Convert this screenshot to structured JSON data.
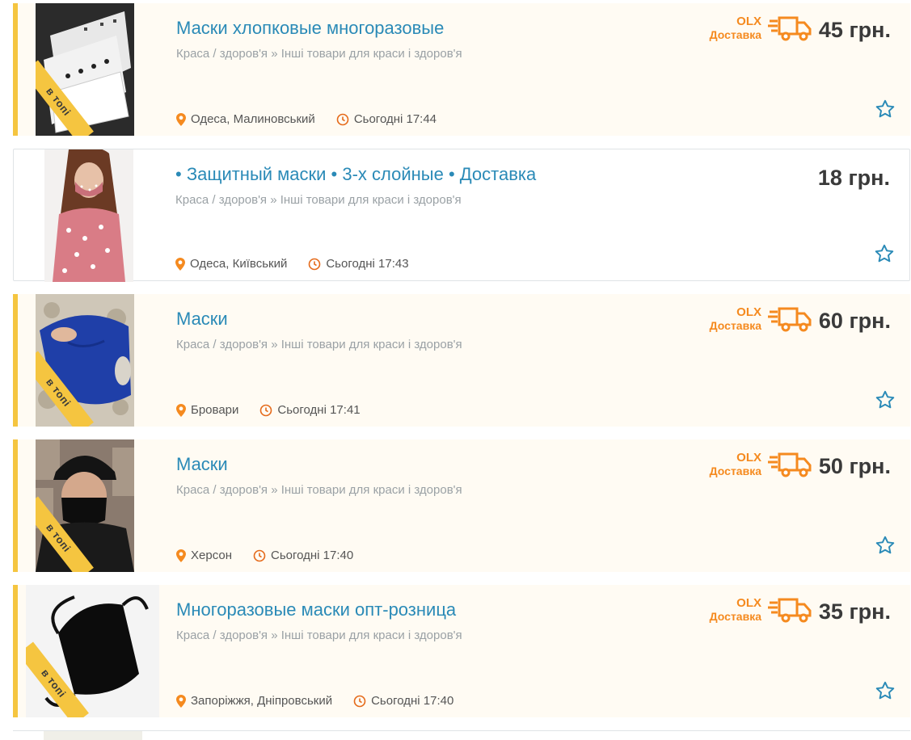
{
  "listings": [
    {
      "title": "Маски хлопковые многоразовые",
      "category": "Краса / здоров'я » Інші товари для краси і здоров'я",
      "location": "Одеса, Малиновський",
      "time": "Сьогодні 17:44",
      "price": "45 грн.",
      "promoted": true,
      "ribbon": "в топі",
      "delivery": {
        "olx": "OLX",
        "label": "Доставка"
      }
    },
    {
      "title": "• Защитный маски • 3-х слойные • Доставка",
      "category": "Краса / здоров'я » Інші товари для краси і здоров'я",
      "location": "Одеса, Київський",
      "time": "Сьогодні 17:43",
      "price": "18 грн.",
      "promoted": false
    },
    {
      "title": "Маски",
      "category": "Краса / здоров'я » Інші товари для краси і здоров'я",
      "location": "Бровари",
      "time": "Сьогодні 17:41",
      "price": "60 грн.",
      "promoted": true,
      "ribbon": "в топі",
      "delivery": {
        "olx": "OLX",
        "label": "Доставка"
      }
    },
    {
      "title": "Маски",
      "category": "Краса / здоров'я » Інші товари для краси і здоров'я",
      "location": "Херсон",
      "time": "Сьогодні 17:40",
      "price": "50 грн.",
      "promoted": true,
      "ribbon": "в топі",
      "delivery": {
        "olx": "OLX",
        "label": "Доставка"
      }
    },
    {
      "title": "Многоразовые маски опт-розница",
      "category": "Краса / здоров'я » Інші товари для краси і здоров'я",
      "location": "Запоріжжя, Дніпровський",
      "time": "Сьогодні 17:40",
      "price": "35 грн.",
      "promoted": true,
      "ribbon": "в топі",
      "delivery": {
        "olx": "OLX",
        "label": "Доставка"
      }
    }
  ],
  "colors": {
    "title": "#2a8ab7",
    "promoted_bg": "#fffbf3",
    "promoted_bar": "#f5c540",
    "delivery": "#f58a1f",
    "pin": "#f58a1f"
  },
  "icons": [
    "map-pin-icon",
    "clock-icon",
    "delivery-truck-icon",
    "favorite-star-icon"
  ]
}
